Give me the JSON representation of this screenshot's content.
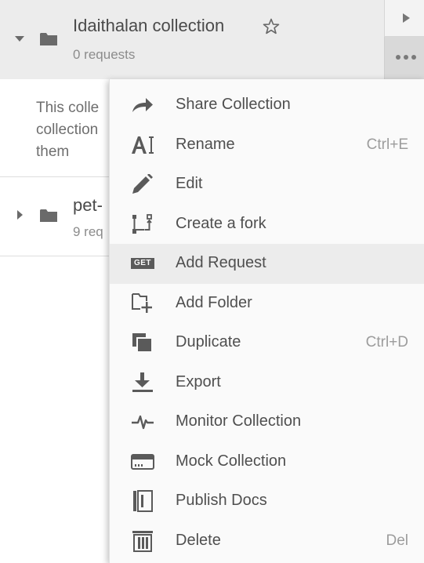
{
  "collection": {
    "name": "Idaithalan collection",
    "subtitle": "0 requests",
    "description_lines": [
      "This colle",
      "collection",
      "them"
    ]
  },
  "second_collection": {
    "name": "pet-",
    "subtitle": "9 req"
  },
  "menu": {
    "items": [
      {
        "icon": "share-icon",
        "label": "Share Collection",
        "shortcut": ""
      },
      {
        "icon": "rename-icon",
        "label": "Rename",
        "shortcut": "Ctrl+E"
      },
      {
        "icon": "pencil-icon",
        "label": "Edit",
        "shortcut": ""
      },
      {
        "icon": "fork-icon",
        "label": "Create a fork",
        "shortcut": ""
      },
      {
        "icon": "get-request-icon",
        "label": "Add Request",
        "shortcut": ""
      },
      {
        "icon": "add-folder-icon",
        "label": "Add Folder",
        "shortcut": ""
      },
      {
        "icon": "duplicate-icon",
        "label": "Duplicate",
        "shortcut": "Ctrl+D"
      },
      {
        "icon": "download-icon",
        "label": "Export",
        "shortcut": ""
      },
      {
        "icon": "monitor-icon",
        "label": "Monitor Collection",
        "shortcut": ""
      },
      {
        "icon": "mock-server-icon",
        "label": "Mock Collection",
        "shortcut": ""
      },
      {
        "icon": "docs-icon",
        "label": "Publish Docs",
        "shortcut": ""
      },
      {
        "icon": "trash-icon",
        "label": "Delete",
        "shortcut": "Del"
      }
    ],
    "get_badge": "GET"
  },
  "colors": {
    "icon": "#5a5a5a",
    "selected_bg": "#ececec",
    "active_item_bg": "#ececec"
  }
}
